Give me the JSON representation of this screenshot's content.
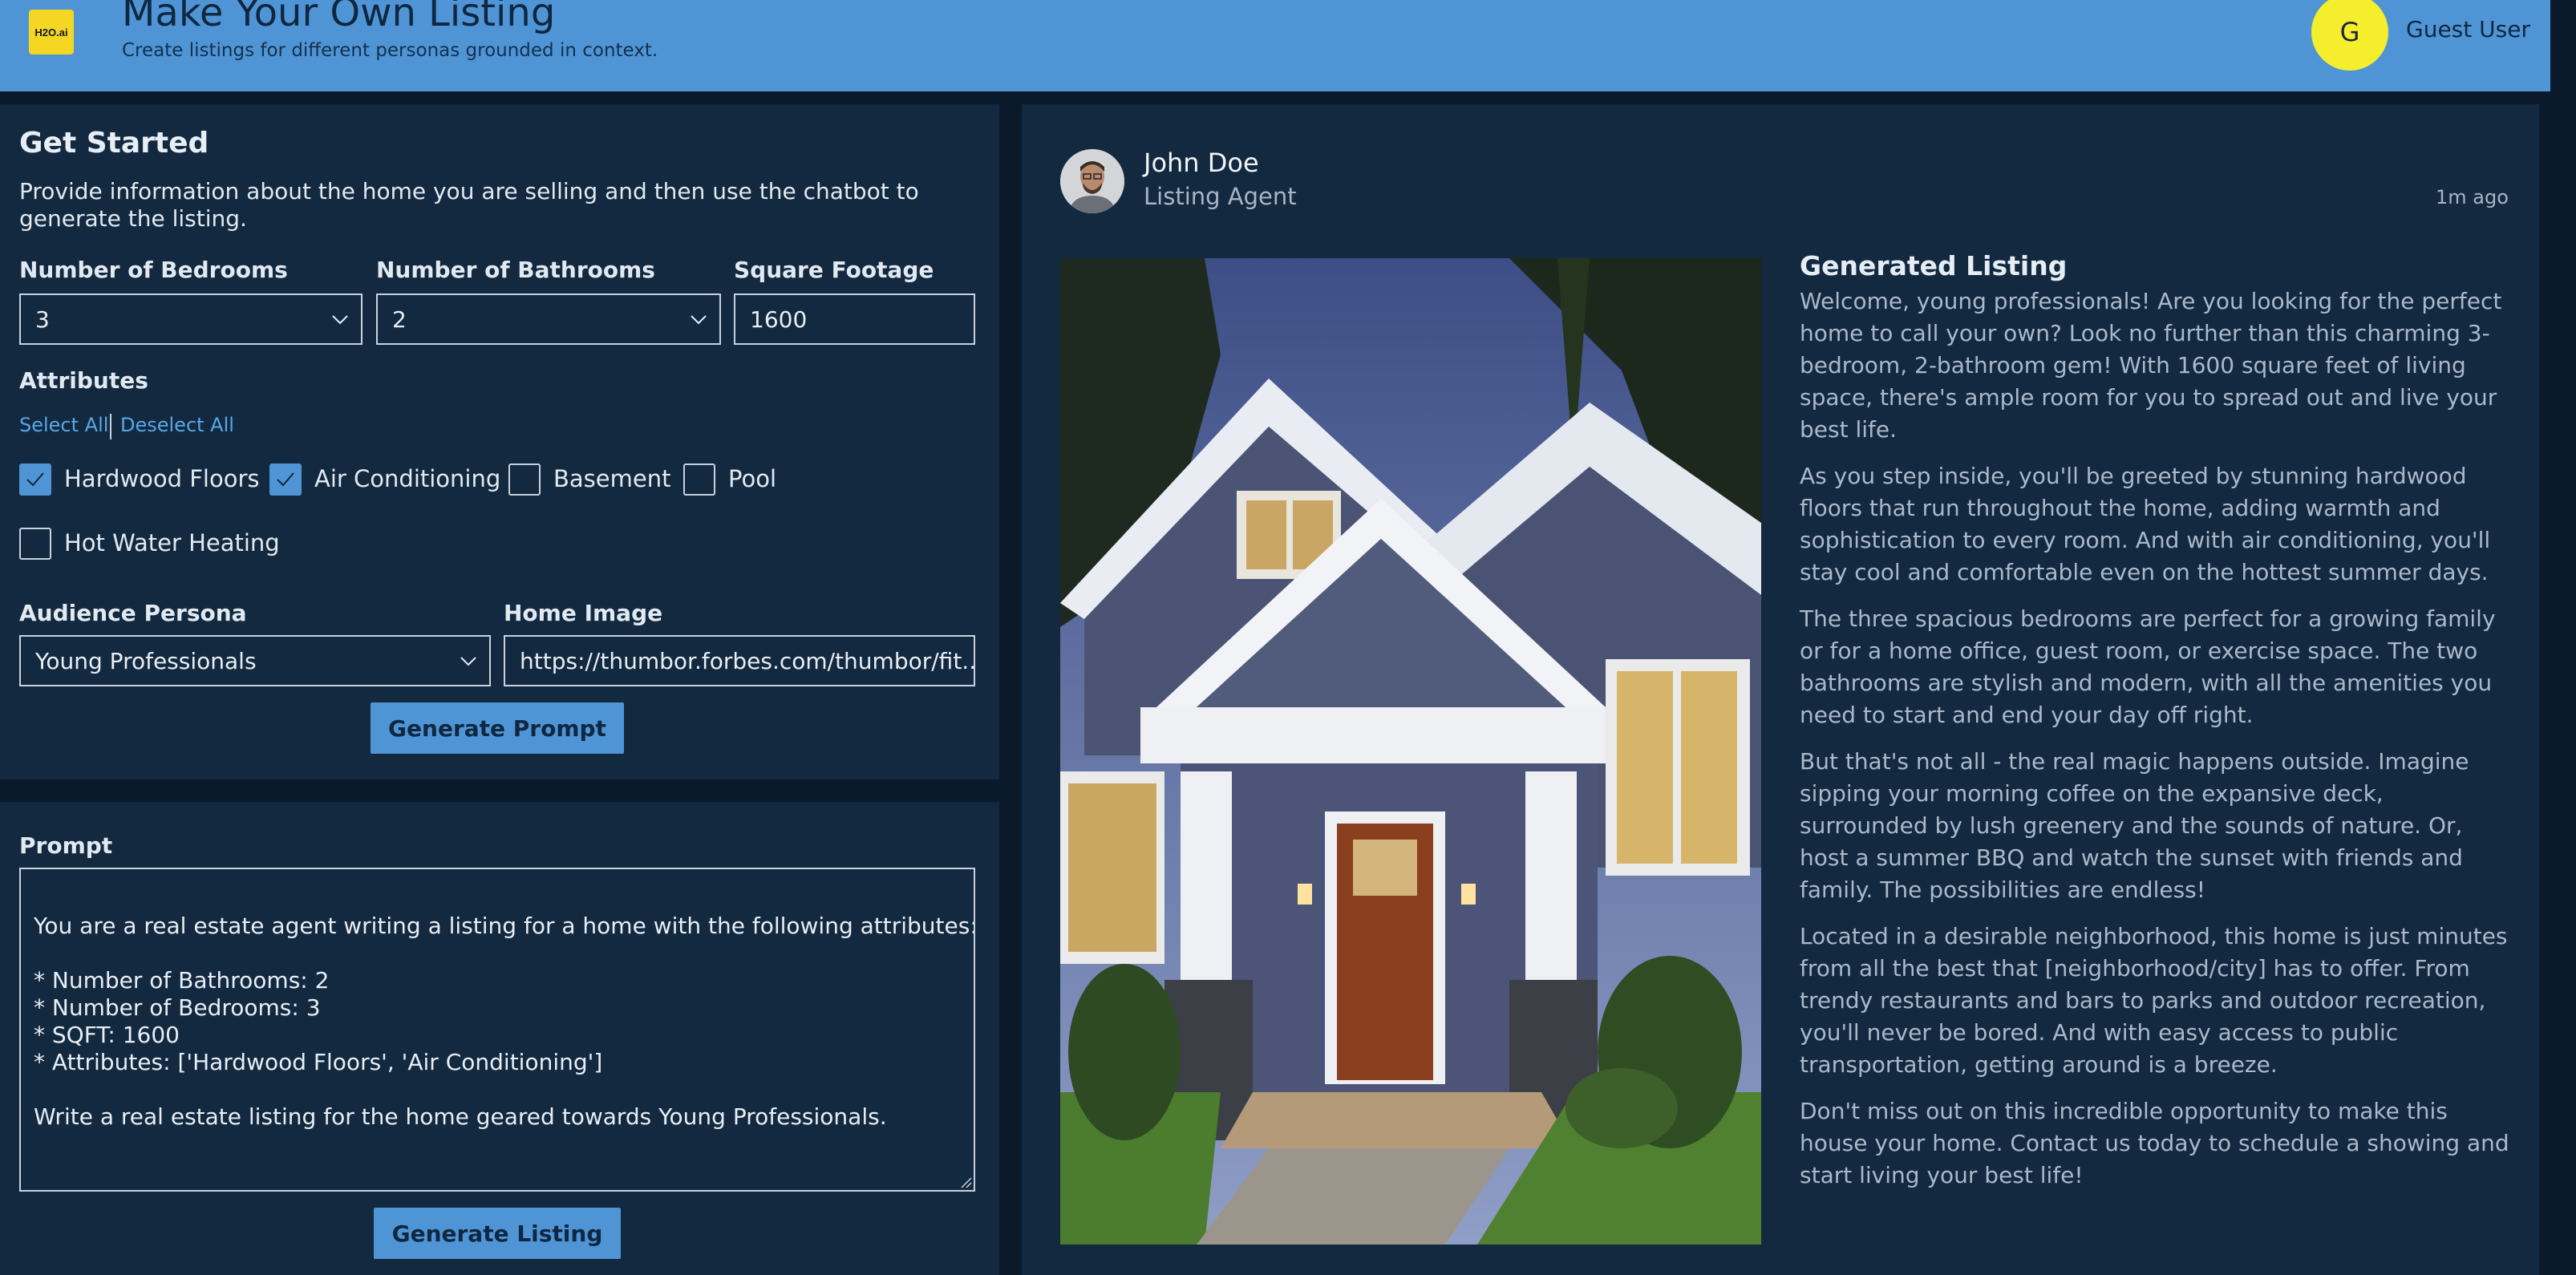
{
  "header": {
    "logo_text": "H2O.ai",
    "title": "Make Your Own Listing",
    "subtitle": "Create listings for different personas grounded in context.",
    "avatar_initial": "G",
    "user_name": "Guest User",
    "colors": {
      "header_bg": "#4f95d5",
      "avatar_bg": "#f5ee2c",
      "logo_bg": "#f5d622"
    }
  },
  "get_started": {
    "title": "Get Started",
    "description": "Provide information about the home you are selling and then use the chatbot to generate the listing.",
    "bedrooms": {
      "label": "Number of Bedrooms",
      "value": "3"
    },
    "bathrooms": {
      "label": "Number of Bathrooms",
      "value": "2"
    },
    "sqft": {
      "label": "Square Footage",
      "value": "1600"
    },
    "attributes": {
      "label": "Attributes",
      "select_all": "Select All",
      "deselect_all": "Deselect All",
      "items": [
        {
          "label": "Hardwood Floors",
          "checked": true
        },
        {
          "label": "Air Conditioning",
          "checked": true
        },
        {
          "label": "Basement",
          "checked": false
        },
        {
          "label": "Pool",
          "checked": false
        },
        {
          "label": "Hot Water Heating",
          "checked": false
        }
      ]
    },
    "persona": {
      "label": "Audience Persona",
      "value": "Young Professionals"
    },
    "home_image": {
      "label": "Home Image",
      "value": "https://thumbor.forbes.com/thumbor/fit..."
    },
    "generate_prompt_label": "Generate Prompt"
  },
  "prompt": {
    "label": "Prompt",
    "text": "\nYou are a real estate agent writing a listing for a home with the following attributes:\n\n* Number of Bathrooms: 2\n* Number of Bedrooms: 3\n* SQFT: 1600\n* Attributes: ['Hardwood Floors', 'Air Conditioning']\n\nWrite a real estate listing for the home geared towards Young Professionals.",
    "generate_listing_label": "Generate Listing"
  },
  "listing": {
    "agent_name": "John Doe",
    "agent_role": "Listing Agent",
    "time_ago": "1m ago",
    "title": "Generated Listing",
    "paragraphs": [
      "Welcome, young professionals! Are you looking for the perfect home to call your own? Look no further than this charming 3-bedroom, 2-bathroom gem! With 1600 square feet of living space, there's ample room for you to spread out and live your best life.",
      "As you step inside, you'll be greeted by stunning hardwood floors that run throughout the home, adding warmth and sophistication to every room. And with air conditioning, you'll stay cool and comfortable even on the hottest summer days.",
      "The three spacious bedrooms are perfect for a growing family or for a home office, guest room, or exercise space. The two bathrooms are stylish and modern, with all the amenities you need to start and end your day off right.",
      "But that's not all - the real magic happens outside. Imagine sipping your morning coffee on the expansive deck, surrounded by lush greenery and the sounds of nature. Or, host a summer BBQ and watch the sunset with friends and family. The possibilities are endless!",
      "Located in a desirable neighborhood, this home is just minutes from all the best that [neighborhood/city] has to offer. From trendy restaurants and bars to parks and outdoor recreation, you'll never be bored. And with easy access to public transportation, getting around is a breeze.",
      "Don't miss out on this incredible opportunity to make this house your home. Contact us today to schedule a showing and start living your best life!"
    ]
  }
}
